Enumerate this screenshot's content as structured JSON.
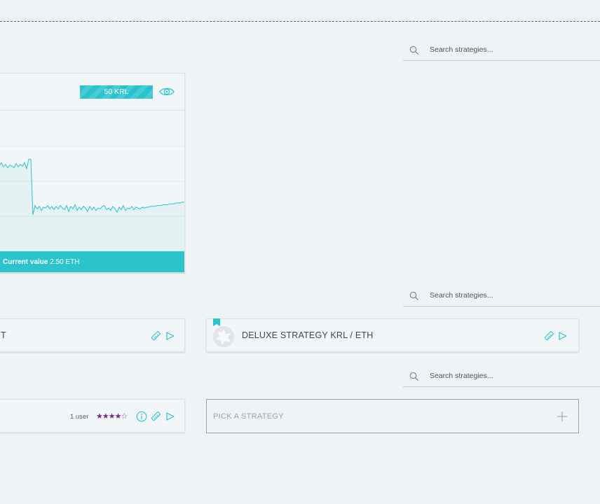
{
  "search": {
    "placeholder_1": "Search strategies...",
    "placeholder_2": "Search strategies...",
    "placeholder_3": "Search strategies..."
  },
  "chart_card": {
    "badge_label": "50 KRL",
    "footer_label": "Current value",
    "footer_value": "2.50 ETH"
  },
  "chart_data": {
    "type": "area",
    "title": "",
    "xlabel": "",
    "ylabel": "",
    "x": [
      0,
      3,
      6,
      9,
      12,
      15,
      18,
      21,
      24,
      27,
      30,
      33,
      36,
      39,
      42,
      45,
      48,
      51,
      54,
      57,
      60,
      63,
      66,
      69,
      72,
      75,
      78,
      81,
      84,
      87,
      90,
      93,
      96,
      99,
      102,
      105,
      108,
      111,
      114,
      117,
      120,
      123,
      126,
      129,
      132,
      135,
      138,
      141,
      144,
      147,
      150,
      153,
      156,
      159,
      162,
      165,
      168,
      171,
      174,
      177,
      180,
      183,
      186,
      189,
      192,
      195,
      198,
      201,
      204,
      207,
      210,
      213,
      216,
      219,
      222,
      225,
      228,
      231,
      234,
      237,
      240,
      243,
      246,
      249,
      252,
      255,
      258,
      261,
      264
    ],
    "values": [
      64,
      68,
      63,
      66,
      62,
      65,
      64,
      62,
      67,
      63,
      66,
      64,
      68,
      61,
      72,
      72,
      6,
      17,
      13,
      16,
      11,
      15,
      14,
      17,
      13,
      16,
      12,
      16,
      13,
      17,
      14,
      12,
      17,
      10,
      16,
      13,
      18,
      11,
      15,
      12,
      16,
      14,
      10,
      16,
      12,
      15,
      11,
      14,
      13,
      16,
      17,
      12,
      14,
      11,
      16,
      13,
      9,
      15,
      12,
      17,
      11,
      14,
      13,
      16,
      12,
      15,
      14,
      13,
      15,
      14,
      15,
      15,
      16,
      16,
      16,
      17,
      17,
      17,
      18,
      18,
      18,
      19,
      19,
      19,
      20,
      20,
      20,
      21,
      21
    ],
    "color": "#2bc4cd"
  },
  "rows": {
    "row1_title": "T",
    "row2_title": "DELUXE STRATEGY KRL / ETH",
    "row3_users": "1 user",
    "row3_stars": "★★★★",
    "row3_star_empty": "☆",
    "pick_label": "PICK A STRATEGY"
  },
  "colors": {
    "accent": "#2bc4cd",
    "star": "#7c2a86"
  }
}
